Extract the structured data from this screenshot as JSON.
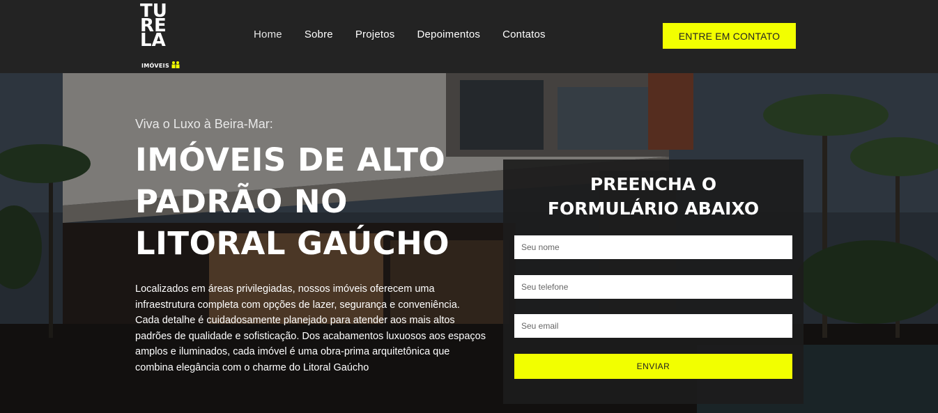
{
  "brand": {
    "logo_lines": [
      "TU",
      "RE",
      "LA"
    ],
    "logo_sub": "IMÓVEIS",
    "accent": "#f2ff00",
    "header_bg": "#232323"
  },
  "nav": {
    "items": [
      "Home",
      "Sobre",
      "Projetos",
      "Depoimentos",
      "Contatos"
    ]
  },
  "header": {
    "cta_label": "ENTRE EM CONTATO"
  },
  "hero": {
    "kicker": "Viva o Luxo à Beira-Mar:",
    "title_lines": [
      "IMÓVEIS DE ALTO",
      "PADRÃO NO",
      "LITORAL GAÚCHO"
    ],
    "description_lines": [
      "Localizados em áreas privilegiadas, nossos imóveis oferecem uma",
      "infraestrutura completa com opções de lazer, segurança e conveniência.",
      "Cada detalhe é cuidadosamente planejado para atender aos mais altos",
      "padrões de qualidade e sofisticação. Dos acabamentos luxuosos aos espaços",
      "amplos e iluminados, cada imóvel é uma obra-prima arquitetônica que",
      "combina elegância com o charme do Litoral Gaúcho"
    ]
  },
  "form": {
    "title_lines": [
      "PREENCHA O",
      "FORMULÁRIO ABAIXO"
    ],
    "name_placeholder": "Seu nome",
    "phone_placeholder": "Seu telefone",
    "email_placeholder": "Seu email",
    "submit_label": "ENVIAR"
  }
}
